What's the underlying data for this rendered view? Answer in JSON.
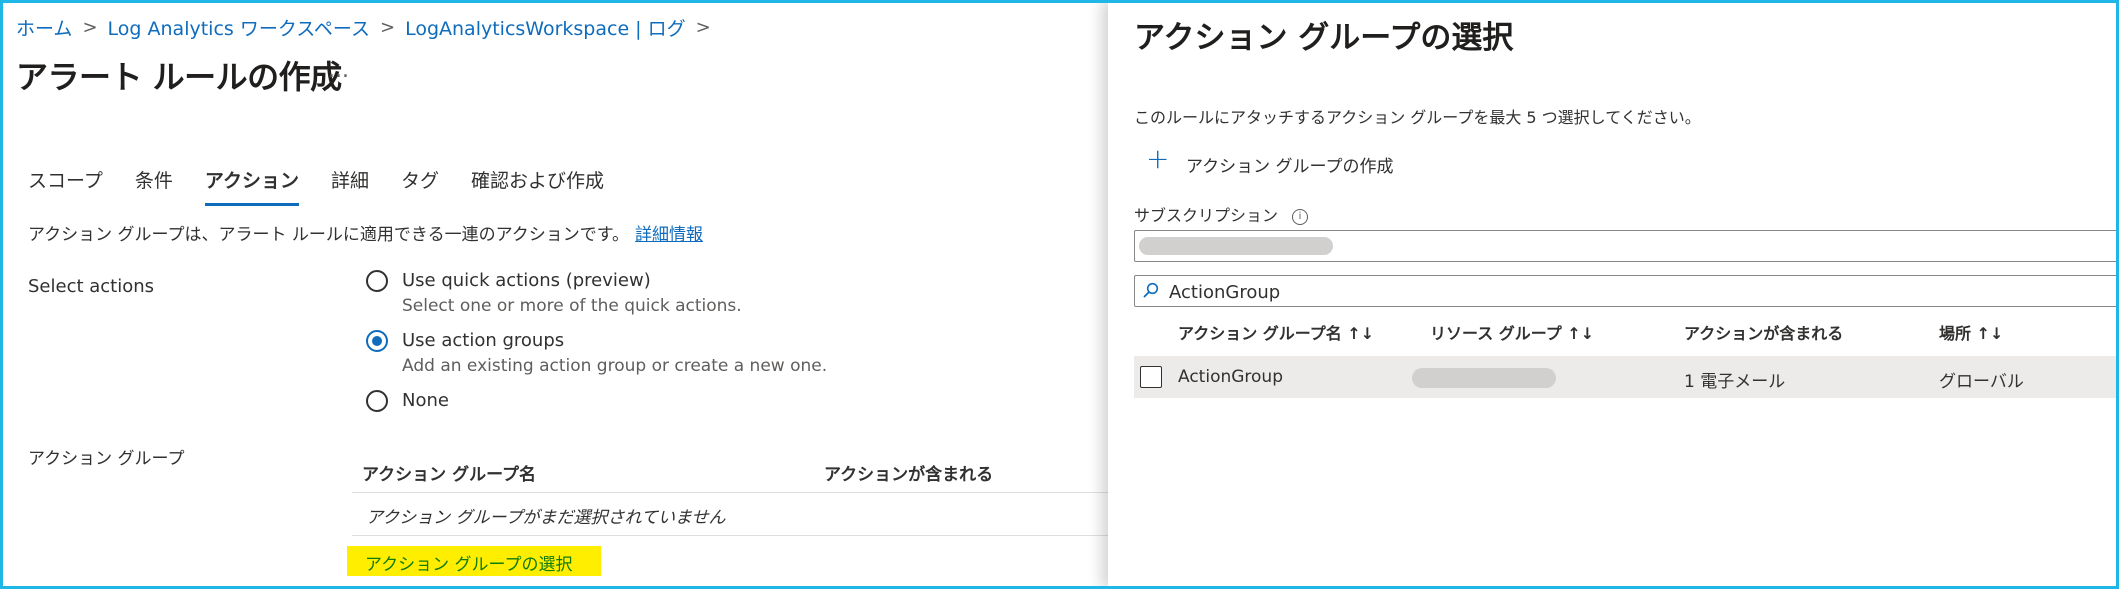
{
  "breadcrumb": {
    "items": [
      "ホーム",
      "Log Analytics ワークスペース",
      "LogAnalyticsWorkspace | ログ"
    ],
    "separator": ">"
  },
  "page": {
    "title": "アラート ルールの作成",
    "more": "..."
  },
  "tabs": [
    "スコープ",
    "条件",
    "アクション",
    "詳細",
    "タグ",
    "確認および作成"
  ],
  "active_tab": "アクション",
  "description": {
    "text": "アクション グループは、アラート ルールに適用できる一連のアクションです。",
    "link": "詳細情報"
  },
  "select_actions": {
    "label": "Select actions",
    "options": [
      {
        "title": "Use quick actions (preview)",
        "sub": "Select one or more of the quick actions.",
        "checked": false
      },
      {
        "title": "Use action groups",
        "sub": "Add an existing action group or create a new one.",
        "checked": true
      },
      {
        "title": "None",
        "sub": "",
        "checked": false
      }
    ]
  },
  "action_groups": {
    "label": "アクション グループ",
    "columns": [
      "アクション グループ名",
      "アクションが含まれる"
    ],
    "empty_text": "アクション グループがまだ選択されていません",
    "select_button": "アクション グループの選択"
  },
  "panel": {
    "title": "アクション グループの選択",
    "description": "このルールにアタッチするアクション グループを最大 5 つ選択してください。",
    "create_label": "アクション グループの作成",
    "subscription_label": "サブスクリプション",
    "info_icon": "i",
    "search_value": "ActionGroup",
    "columns": [
      "アクション グループ名 ↑↓",
      "リソース グループ ↑↓",
      "アクションが含まれる",
      "場所 ↑↓"
    ],
    "rows": [
      {
        "name": "ActionGroup",
        "resource_group": "",
        "actions": "1 電子メール",
        "location": "グローバル"
      }
    ]
  },
  "colors": {
    "accent": "#0f6cbd",
    "highlight": "#ffee00",
    "frame": "#1fb6e8",
    "green_text": "#107c10"
  }
}
